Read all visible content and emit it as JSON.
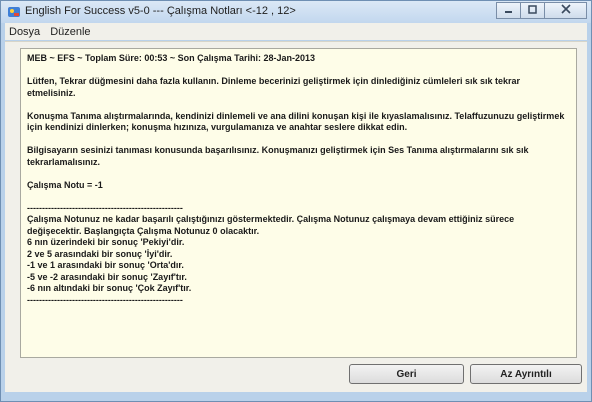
{
  "window": {
    "title": "English For Success v5-0  ---  Çalışma Notları <-12 , 12>",
    "icon": "app-icon",
    "controls": {
      "minimize": "minimize-icon",
      "maximize": "maximize-icon",
      "close": "close-icon"
    }
  },
  "menu": {
    "items": [
      "Dosya",
      "Düzenle"
    ]
  },
  "report": {
    "lines": [
      "MEB ~ EFS ~ Toplam Süre: 00:53 ~ Son Çalışma Tarihi: 28-Jan-2013",
      "",
      "Lütfen, Tekrar düğmesini daha fazla kullanın.  Dinleme becerinizi geliştirmek için dinlediğiniz cümleleri sık sık tekrar etmelisiniz.",
      "",
      "Konuşma Tanıma alıştırmalarında, kendinizi dinlemeli ve ana dilini konuşan kişi ile kıyaslamalısınız.  Telaffuzunuzu geliştirmek için kendinizi dinlerken; konuşma hızınıza, vurgulamanıza ve anahtar seslere dikkat edin.",
      "",
      "Bilgisayarın sesinizi tanıması konusunda başarılısınız.  Konuşmanızı geliştirmek için Ses Tanıma alıştırmalarını sık sık tekrarlamalısınız.",
      "",
      "Çalışma Notu = -1",
      "",
      "----------------------------------------------------",
      "Çalışma Notunuz ne kadar başarılı çalıştığınızı göstermektedir.  Çalışma Notunuz çalışmaya devam ettiğiniz sürece değişecektir.  Başlangıçta Çalışma Notunuz  0  olacaktır.",
      " 6 nın üzerindeki bir sonuç 'Pekiyi'dir.",
      " 2 ve 5 arasındaki bir sonuç 'İyi'dir.",
      " -1 ve 1 arasındaki bir sonuç 'Orta'dır.",
      " -5 ve -2 arasındaki bir sonuç 'Zayıf'tır.",
      " -6 nın altındaki bir sonuç 'Çok Zayıf'tır.",
      "----------------------------------------------------"
    ]
  },
  "buttons": {
    "back": "Geri",
    "less_detail": "Az Ayrıntılı"
  }
}
